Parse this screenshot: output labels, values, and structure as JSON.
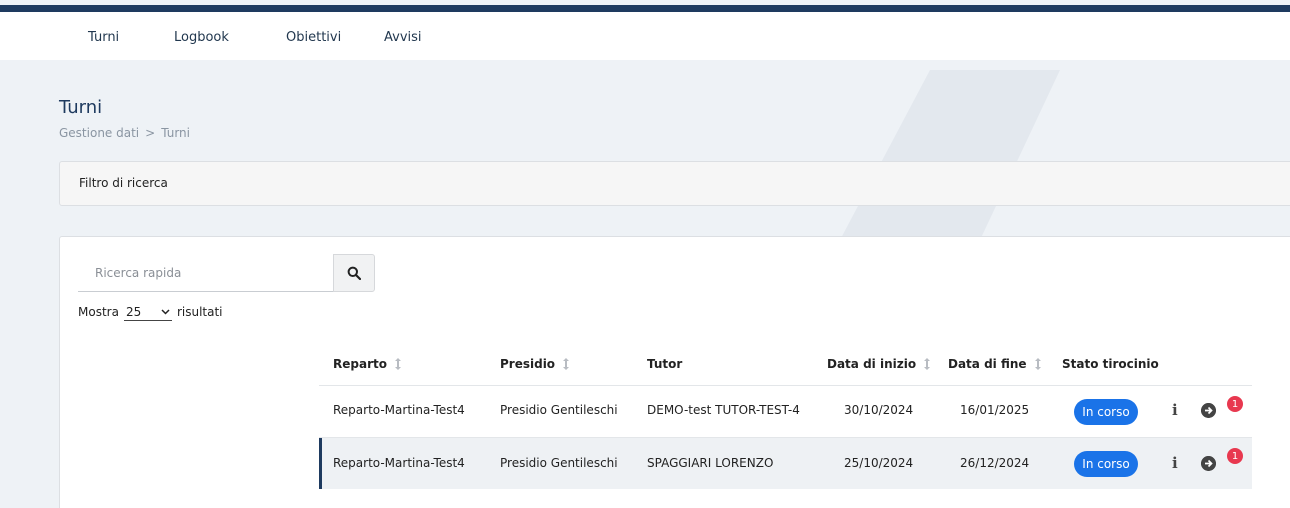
{
  "nav": {
    "items": [
      {
        "label": "Turni",
        "key": "turni"
      },
      {
        "label": "Logbook",
        "key": "logbook"
      },
      {
        "label": "Obiettivi",
        "key": "obiettivi"
      },
      {
        "label": "Avvisi",
        "key": "avvisi"
      }
    ]
  },
  "page": {
    "title": "Turni",
    "breadcrumb": {
      "root": "Gestione dati",
      "separator": ">",
      "current": "Turni"
    }
  },
  "filter": {
    "title": "Filtro di ricerca"
  },
  "search": {
    "placeholder": "Ricerca rapida",
    "icon": "search-icon"
  },
  "length": {
    "prefix": "Mostra",
    "value": "25",
    "suffix": "risultati"
  },
  "table": {
    "headers": {
      "reparto": "Reparto",
      "presidio": "Presidio",
      "tutor": "Tutor",
      "data_inizio": "Data di inizio",
      "data_fine": "Data di fine",
      "stato": "Stato tirocinio"
    },
    "rows": [
      {
        "reparto": "Reparto-Martina-Test4",
        "presidio": "Presidio Gentileschi",
        "tutor": "DEMO-test TUTOR-TEST-4",
        "data_inizio": "30/10/2024",
        "data_fine": "16/01/2025",
        "stato": "In corso",
        "notifications": "1"
      },
      {
        "reparto": "Reparto-Martina-Test4",
        "presidio": "Presidio Gentileschi",
        "tutor": "SPAGGIARI LORENZO",
        "data_inizio": "25/10/2024",
        "data_fine": "26/12/2024",
        "stato": "In corso",
        "notifications": "1"
      }
    ]
  },
  "colors": {
    "brand": "#1e3a5f",
    "badge": "#1a73e8",
    "notification": "#e8384f"
  }
}
